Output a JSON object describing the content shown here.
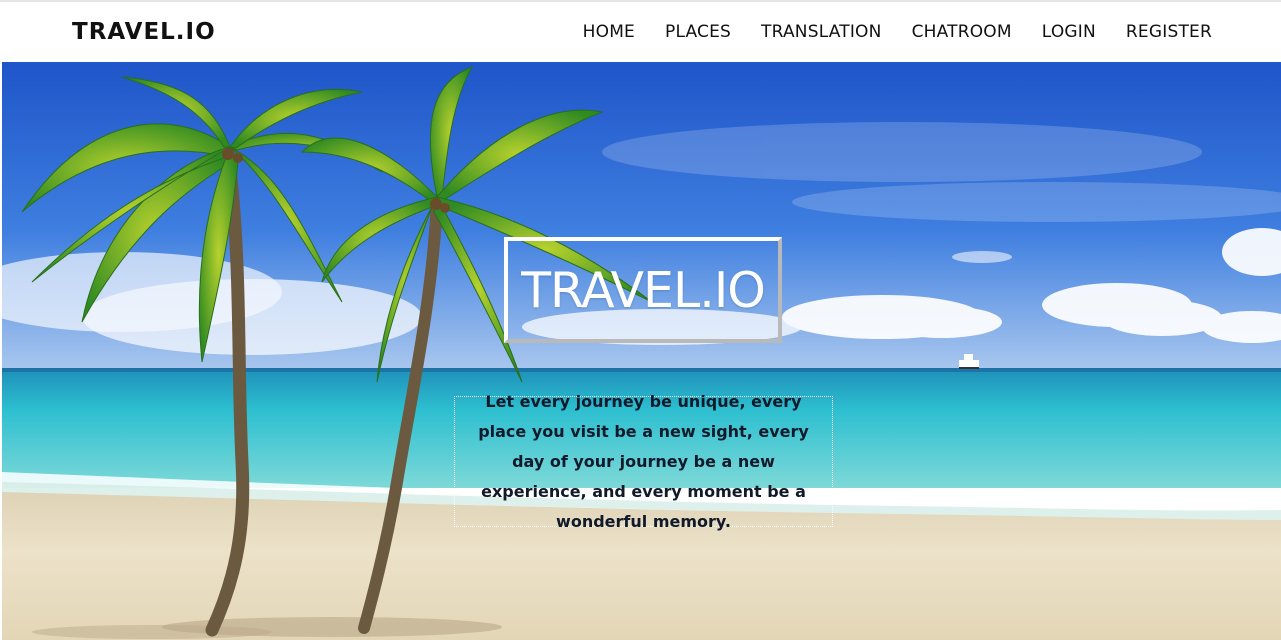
{
  "navbar": {
    "brand": "TRAVEL.IO",
    "links": [
      "HOME",
      "PLACES",
      "TRANSLATION",
      "CHATROOM",
      "LOGIN",
      "REGISTER"
    ]
  },
  "hero": {
    "title": "TRAVEL.IO",
    "tagline": "Let every journey be unique, every place you visit be a new sight, every day of your journey be a new experience, and every moment be a wonderful memory.",
    "background": "beach-palm-trees-image"
  },
  "colors": {
    "nav_bg": "#ffffff",
    "nav_text": "#111111",
    "sky": "#2f6cd8",
    "sea": "#2fc3d2",
    "sand": "#eadfc6"
  }
}
